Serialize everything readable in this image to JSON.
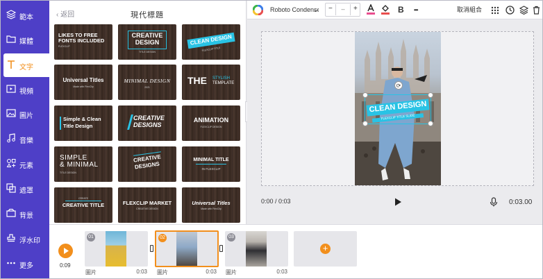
{
  "sidebar": {
    "items": [
      {
        "label": "範本",
        "icon": "layers-icon"
      },
      {
        "label": "媒體",
        "icon": "folder-icon"
      },
      {
        "label": "文字",
        "icon": "text-icon",
        "active": true
      },
      {
        "label": "視頻",
        "icon": "video-icon"
      },
      {
        "label": "圖片",
        "icon": "image-icon"
      },
      {
        "label": "音樂",
        "icon": "music-icon"
      },
      {
        "label": "元素",
        "icon": "elements-icon"
      },
      {
        "label": "遮罩",
        "icon": "overlay-icon"
      },
      {
        "label": "背景",
        "icon": "background-icon"
      },
      {
        "label": "浮水印",
        "icon": "watermark-icon"
      },
      {
        "label": "更多",
        "icon": "more-icon"
      }
    ]
  },
  "panel": {
    "back_label": "返回",
    "title": "現代標題",
    "templates": [
      {
        "lines": [
          "LIKES TO FREE",
          "FONTS INCLUDED"
        ],
        "sub": "FLEXCLIP"
      },
      {
        "lines": [
          "CREATIVE",
          "DESIGN"
        ],
        "sub": "TITLE DESIGN"
      },
      {
        "lines": [
          "CLEAN DESIGN"
        ],
        "sub": "FLEXCLIP TITLE"
      },
      {
        "lines": [
          "Universal Titles"
        ],
        "sub": "Made with FlexClip"
      },
      {
        "lines": [
          "MINIMAL DESIGN"
        ],
        "sub": "2021"
      },
      {
        "lines": [
          "THE",
          "STYLISH",
          "TEMPLATE"
        ],
        "sub": ""
      },
      {
        "lines": [
          "Simple & Clean",
          "Title Design"
        ],
        "sub": ""
      },
      {
        "lines": [
          "CREATIVE",
          "DESIGNS"
        ],
        "sub": ""
      },
      {
        "lines": [
          "ANIMATION"
        ],
        "sub": "FLEXCLIP DESIGN"
      },
      {
        "lines": [
          "SIMPLE",
          "& MINIMAL"
        ],
        "sub": "TITLE DESIGN"
      },
      {
        "lines": [
          "CREATIVE",
          "DESIGNS"
        ],
        "sub": ""
      },
      {
        "lines": [
          "MINIMAL TITLE"
        ],
        "sub": "IN FLEXCLIP"
      },
      {
        "lines": [
          "CREATIVE TITLE"
        ],
        "sub": "CREATE"
      },
      {
        "lines": [
          "FLEXCLIP MARKET"
        ],
        "sub": "CREATIVE DESIGN"
      },
      {
        "lines": [
          "Universal Titles"
        ],
        "sub": "Made with FlexClip"
      }
    ]
  },
  "toolbar": {
    "font_name": "Roboto Condensed",
    "font_size": "--",
    "minus": "−",
    "plus": "+",
    "bold": "B",
    "more": "•••",
    "ungroup": "取消組合"
  },
  "canvas": {
    "overlay_title": "CLEAN DESIGN",
    "overlay_sub": "FLEXCLIP TITLE SLIDE",
    "rotate_glyph": "⟳"
  },
  "player": {
    "current": "0:00 / 0:03",
    "total": "0:03.00"
  },
  "timeline": {
    "play_time": "0:09",
    "clips": [
      {
        "num": "01",
        "label": "圖片",
        "duration": "0:03",
        "selected": false
      },
      {
        "num": "02",
        "label": "圖片",
        "duration": "0:03",
        "selected": true
      },
      {
        "num": "03",
        "label": "圖片",
        "duration": "0:03",
        "selected": false
      }
    ],
    "add_glyph": "+"
  },
  "colors": {
    "sidebar": "#4e3fc7",
    "accent": "#f28f1c",
    "teal": "#29c3e5"
  }
}
